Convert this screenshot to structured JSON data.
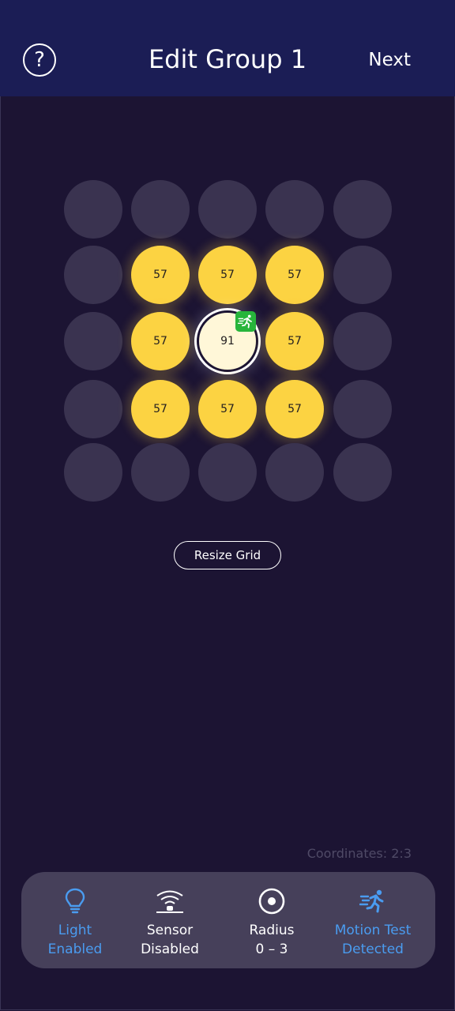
{
  "header": {
    "help_label": "?",
    "title": "Edit Group 1",
    "next_label": "Next"
  },
  "grid": {
    "rows": [
      [
        null,
        null,
        null,
        null,
        null
      ],
      [
        null,
        "57",
        "57",
        "57",
        null
      ],
      [
        null,
        "57",
        "91",
        "57",
        null
      ],
      [
        null,
        "57",
        "57",
        "57",
        null
      ],
      [
        null,
        null,
        null,
        null,
        null
      ]
    ],
    "selected": [
      2,
      2
    ],
    "motion_badge_icon": "running-person-icon"
  },
  "resize_label": "Resize Grid",
  "coordinates": "Coordinates: 2:3",
  "toolbar": {
    "light": {
      "line1": "Light",
      "line2": "Enabled",
      "icon": "lightbulb-icon"
    },
    "sensor": {
      "line1": "Sensor",
      "line2": "Disabled",
      "icon": "sensor-waves-icon"
    },
    "radius": {
      "line1": "Radius",
      "line2": "0 – 3",
      "icon": "radius-target-icon"
    },
    "motion": {
      "line1": "Motion Test",
      "line2": "Detected",
      "icon": "running-person-icon"
    }
  },
  "colors": {
    "header_bg": "#1b1d55",
    "page_bg": "#1c1433",
    "light_on": "#fcd342",
    "light_off": "#3a3350",
    "selected": "#fff7d8",
    "accent": "#4a9cf0",
    "motion_badge": "#27b53b"
  }
}
